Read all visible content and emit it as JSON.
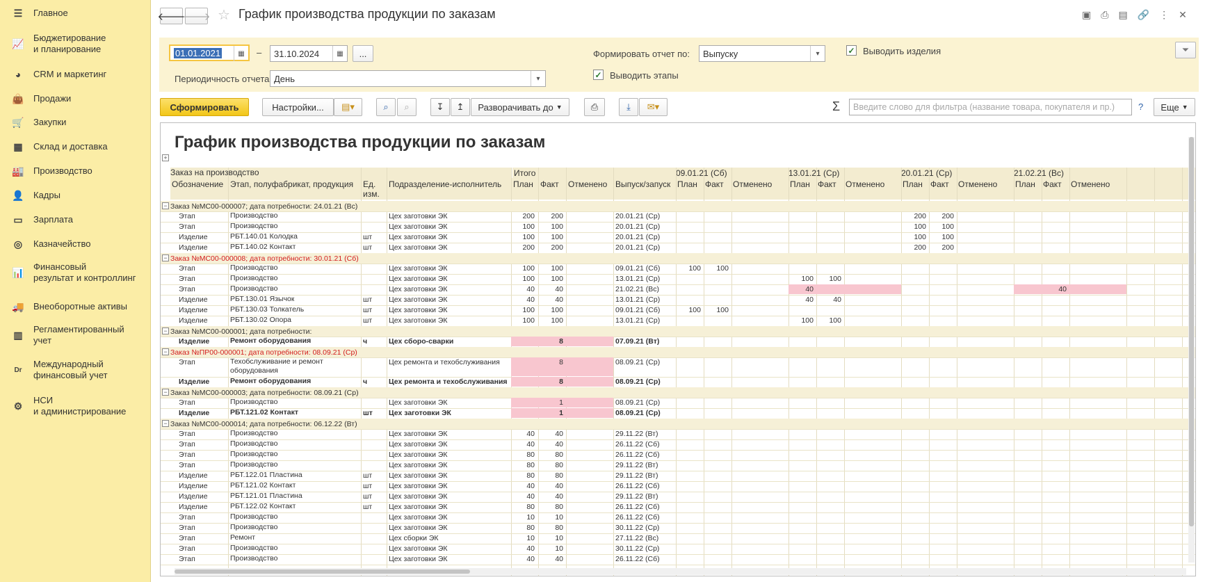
{
  "sidebar": {
    "items": [
      {
        "label": "Главное",
        "icon": "menu-icon"
      },
      {
        "label": "Бюджетирование\nи планирование",
        "icon": "chart-icon"
      },
      {
        "label": "CRM и маркетинг",
        "icon": "pie-icon"
      },
      {
        "label": "Продажи",
        "icon": "bag-icon"
      },
      {
        "label": "Закупки",
        "icon": "cart-icon"
      },
      {
        "label": "Склад и доставка",
        "icon": "warehouse-icon"
      },
      {
        "label": "Производство",
        "icon": "factory-icon"
      },
      {
        "label": "Кадры",
        "icon": "person-icon"
      },
      {
        "label": "Зарплата",
        "icon": "wallet-icon"
      },
      {
        "label": "Казначейство",
        "icon": "coins-icon"
      },
      {
        "label": "Финансовый\nрезультат и контроллинг",
        "icon": "bar-chart-icon"
      },
      {
        "label": "Внеоборотные активы",
        "icon": "truck-icon"
      },
      {
        "label": "Регламентированный\nучет",
        "icon": "calculator-icon"
      },
      {
        "label": "Международный\nфинансовый учет",
        "icon": "drcr-icon"
      },
      {
        "label": "НСИ\nи администрирование",
        "icon": "gear-icon"
      }
    ]
  },
  "window": {
    "title": "График производства продукции по заказам"
  },
  "filters": {
    "date_from": "01.01.2021",
    "date_sep": "–",
    "date_to": "31.10.2024",
    "ellipsis": "...",
    "periodicity_label": "Периодичность отчета:",
    "periodicity_value": "День",
    "form_by_label": "Формировать отчет по:",
    "form_by_value": "Выпуску",
    "show_items_label": "Выводить изделия",
    "show_stages_label": "Выводить этапы"
  },
  "toolbar": {
    "generate": "Сформировать",
    "settings": "Настройки...",
    "expand_to": "Разворачивать до",
    "search_placeholder": "Введите слово для фильтра (название товара, покупателя и пр.)",
    "sigma": "Σ",
    "help": "?",
    "more": "Еще"
  },
  "report": {
    "title": "График производства продукции по заказам",
    "group_header": "Заказ на производство",
    "columns": {
      "designation": "Обозначение",
      "stage": "Этап, полуфабрикат, продукция",
      "unit": "Ед.\nизм.",
      "division": "Подразделение-исполнитель",
      "release": "Выпуск/запуск",
      "plan": "План",
      "fact": "Факт",
      "cancelled": "Отменено"
    },
    "periods": [
      "Итого",
      "09.01.21 (Сб)",
      "13.01.21 (Ср)",
      "20.01.21 (Ср)",
      "21.02.21 (Вс)"
    ],
    "rows": [
      {
        "type": "group",
        "text": "Заказ №МС00-000007; дата потребности: 24.01.21 (Вс)"
      },
      {
        "d": "Этап",
        "s": "Производство",
        "u": "",
        "dv": "Цех заготовки ЭК",
        "tp": "200",
        "tf": "200",
        "r": "20.01.21 (Ср)",
        "p": [
          [
            "",
            ""
          ],
          [
            "",
            ""
          ],
          [
            "200",
            "200"
          ],
          [
            "",
            ""
          ]
        ]
      },
      {
        "d": "Этап",
        "s": "Производство",
        "u": "",
        "dv": "Цех заготовки ЭК",
        "tp": "100",
        "tf": "100",
        "r": "20.01.21 (Ср)",
        "p": [
          [
            "",
            ""
          ],
          [
            "",
            ""
          ],
          [
            "100",
            "100"
          ],
          [
            "",
            ""
          ]
        ]
      },
      {
        "d": "Изделие",
        "s": "РБТ.140.01 Колодка",
        "u": "шт",
        "dv": "Цех заготовки ЭК",
        "tp": "100",
        "tf": "100",
        "r": "20.01.21 (Ср)",
        "p": [
          [
            "",
            ""
          ],
          [
            "",
            ""
          ],
          [
            "100",
            "100"
          ],
          [
            "",
            ""
          ]
        ]
      },
      {
        "d": "Изделие",
        "s": "РБТ.140.02 Контакт",
        "u": "шт",
        "dv": "Цех заготовки ЭК",
        "tp": "200",
        "tf": "200",
        "r": "20.01.21 (Ср)",
        "p": [
          [
            "",
            ""
          ],
          [
            "",
            ""
          ],
          [
            "200",
            "200"
          ],
          [
            "",
            ""
          ]
        ]
      },
      {
        "type": "group",
        "red": true,
        "text": "Заказ №МС00-000008; дата потребности: 30.01.21 (Сб)"
      },
      {
        "d": "Этап",
        "s": "Производство",
        "u": "",
        "dv": "Цех заготовки ЭК",
        "tp": "100",
        "tf": "100",
        "r": "09.01.21 (Сб)",
        "p": [
          [
            "100",
            "100"
          ],
          [
            "",
            ""
          ],
          [
            "",
            ""
          ],
          [
            "",
            ""
          ]
        ]
      },
      {
        "d": "Этап",
        "s": "Производство",
        "u": "",
        "dv": "Цех заготовки ЭК",
        "tp": "100",
        "tf": "100",
        "r": "13.01.21 (Ср)",
        "p": [
          [
            "",
            ""
          ],
          [
            "100",
            "100"
          ],
          [
            "",
            ""
          ],
          [
            "",
            ""
          ]
        ]
      },
      {
        "d": "Этап",
        "s": "Производство",
        "u": "",
        "dv": "Цех заготовки ЭК",
        "tp": "40",
        "tf": "40",
        "r": "21.02.21 (Вс)",
        "p": [
          [
            "",
            ""
          ],
          [
            "40",
            ""
          ],
          [
            "",
            ""
          ],
          [
            "",
            "40"
          ]
        ],
        "pinkp": [
          1,
          3
        ]
      },
      {
        "d": "Изделие",
        "s": "РБТ.130.01 Язычок",
        "u": "шт",
        "dv": "Цех заготовки ЭК",
        "tp": "40",
        "tf": "40",
        "r": "13.01.21 (Ср)",
        "p": [
          [
            "",
            ""
          ],
          [
            "40",
            "40"
          ],
          [
            "",
            ""
          ],
          [
            "",
            ""
          ]
        ]
      },
      {
        "d": "Изделие",
        "s": "РБТ.130.03 Толкатель",
        "u": "шт",
        "dv": "Цех заготовки ЭК",
        "tp": "100",
        "tf": "100",
        "r": "09.01.21 (Сб)",
        "p": [
          [
            "100",
            "100"
          ],
          [
            "",
            ""
          ],
          [
            "",
            ""
          ],
          [
            "",
            ""
          ]
        ]
      },
      {
        "d": "Изделие",
        "s": "РБТ.130.02 Опора",
        "u": "шт",
        "dv": "Цех заготовки ЭК",
        "tp": "100",
        "tf": "100",
        "r": "13.01.21 (Ср)",
        "p": [
          [
            "",
            ""
          ],
          [
            "100",
            "100"
          ],
          [
            "",
            ""
          ],
          [
            "",
            ""
          ]
        ]
      },
      {
        "type": "group",
        "text": "Заказ №МС00-000001; дата потребности:"
      },
      {
        "d": "Изделие",
        "s": "Ремонт оборудования",
        "u": "ч",
        "dv": "Цех сборо-сварки",
        "tp": "",
        "tf": "8",
        "r": "07.09.21 (Вт)",
        "bold": true,
        "pinkt": true
      },
      {
        "type": "group",
        "red": true,
        "text": "Заказ №ПР00-000001; дата потребности: 08.09.21 (Ср)"
      },
      {
        "d": "Этап",
        "s": "Техобслуживание и ремонт\nоборудования",
        "u": "",
        "dv": "Цех ремонта и техобслуживания",
        "tp": "",
        "tf": "8",
        "r": "08.09.21 (Ср)",
        "pinkt": true,
        "tall": true
      },
      {
        "d": "Изделие",
        "s": "Ремонт оборудования",
        "u": "ч",
        "dv": "Цех ремонта и техобслуживания",
        "tp": "",
        "tf": "8",
        "r": "08.09.21 (Ср)",
        "bold": true,
        "pinkt": true
      },
      {
        "type": "group",
        "text": "Заказ №МС00-000003; дата потребности: 08.09.21 (Ср)"
      },
      {
        "d": "Этап",
        "s": "Производство",
        "u": "",
        "dv": "Цех заготовки ЭК",
        "tp": "",
        "tf": "1",
        "r": "08.09.21 (Ср)",
        "pinkt": true
      },
      {
        "d": "Изделие",
        "s": "РБТ.121.02 Контакт",
        "u": "шт",
        "dv": "Цех заготовки ЭК",
        "tp": "",
        "tf": "1",
        "r": "08.09.21 (Ср)",
        "bold": true,
        "pinkt": true
      },
      {
        "type": "group",
        "text": "Заказ №МС00-000014; дата потребности: 06.12.22 (Вт)"
      },
      {
        "d": "Этап",
        "s": "Производство",
        "u": "",
        "dv": "Цех заготовки ЭК",
        "tp": "40",
        "tf": "40",
        "r": "29.11.22 (Вт)"
      },
      {
        "d": "Этап",
        "s": "Производство",
        "u": "",
        "dv": "Цех заготовки ЭК",
        "tp": "40",
        "tf": "40",
        "r": "26.11.22 (Сб)"
      },
      {
        "d": "Этап",
        "s": "Производство",
        "u": "",
        "dv": "Цех заготовки ЭК",
        "tp": "80",
        "tf": "80",
        "r": "26.11.22 (Сб)"
      },
      {
        "d": "Этап",
        "s": "Производство",
        "u": "",
        "dv": "Цех заготовки ЭК",
        "tp": "80",
        "tf": "80",
        "r": "29.11.22 (Вт)"
      },
      {
        "d": "Изделие",
        "s": "РБТ.122.01 Пластина",
        "u": "шт",
        "dv": "Цех заготовки ЭК",
        "tp": "80",
        "tf": "80",
        "r": "29.11.22 (Вт)"
      },
      {
        "d": "Изделие",
        "s": "РБТ.121.02 Контакт",
        "u": "шт",
        "dv": "Цех заготовки ЭК",
        "tp": "40",
        "tf": "40",
        "r": "26.11.22 (Сб)"
      },
      {
        "d": "Изделие",
        "s": "РБТ.121.01 Пластина",
        "u": "шт",
        "dv": "Цех заготовки ЭК",
        "tp": "40",
        "tf": "40",
        "r": "29.11.22 (Вт)"
      },
      {
        "d": "Изделие",
        "s": "РБТ.122.02 Контакт",
        "u": "шт",
        "dv": "Цех заготовки ЭК",
        "tp": "80",
        "tf": "80",
        "r": "26.11.22 (Сб)"
      },
      {
        "d": "Этап",
        "s": "Производство",
        "u": "",
        "dv": "Цех заготовки ЭК",
        "tp": "10",
        "tf": "10",
        "r": "26.11.22 (Сб)"
      },
      {
        "d": "Этап",
        "s": "Производство",
        "u": "",
        "dv": "Цех заготовки ЭК",
        "tp": "80",
        "tf": "80",
        "r": "30.11.22 (Ср)"
      },
      {
        "d": "Этап",
        "s": "Ремонт",
        "u": "",
        "dv": "Цех сборки ЭК",
        "tp": "10",
        "tf": "10",
        "r": "27.11.22 (Вс)"
      },
      {
        "d": "Этап",
        "s": "Производство",
        "u": "",
        "dv": "Цех заготовки ЭК",
        "tp": "40",
        "tf": "10",
        "r": "30.11.22 (Ср)"
      },
      {
        "d": "Этап",
        "s": "Производство",
        "u": "",
        "dv": "Цех заготовки ЭК",
        "tp": "40",
        "tf": "40",
        "r": "26.11.22 (Сб)"
      }
    ]
  }
}
